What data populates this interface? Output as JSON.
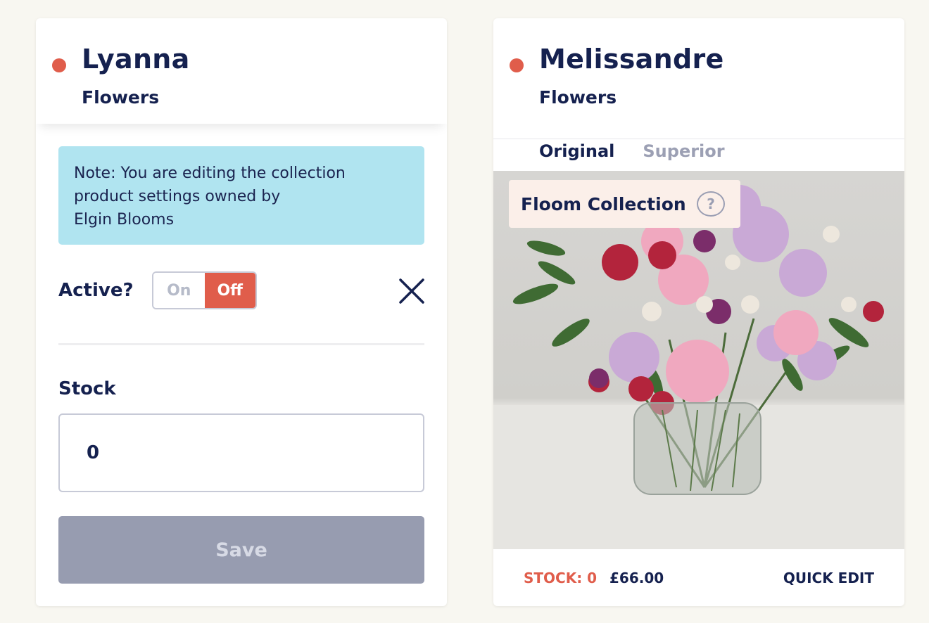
{
  "left_card": {
    "title": "Lyanna",
    "subtitle": "Flowers",
    "note_lines": [
      "Note: You are editing the collection",
      "product settings owned by",
      "Elgin Blooms"
    ],
    "active_label": "Active?",
    "toggle": {
      "on_label": "On",
      "off_label": "Off",
      "selected": "Off"
    },
    "stock_label": "Stock",
    "stock_value": "0",
    "save_label": "Save"
  },
  "right_card": {
    "title": "Melissandre",
    "subtitle": "Flowers",
    "tabs": [
      {
        "label": "Original",
        "active": true
      },
      {
        "label": "Superior",
        "active": false
      }
    ],
    "badge_label": "Floom Collection",
    "help_glyph": "?",
    "stock_status": "STOCK: 0",
    "price": "£66.00",
    "quick_edit_label": "QUICK EDIT"
  },
  "colors": {
    "accent": "#e05d4b",
    "navy": "#15214f",
    "note_bg": "#b0e4f0",
    "badge_bg": "#fbefe9",
    "disabled_button": "#979cb0",
    "page_bg": "#f8f7f1"
  },
  "icons": [
    "status-dot",
    "close-icon",
    "help-icon"
  ]
}
